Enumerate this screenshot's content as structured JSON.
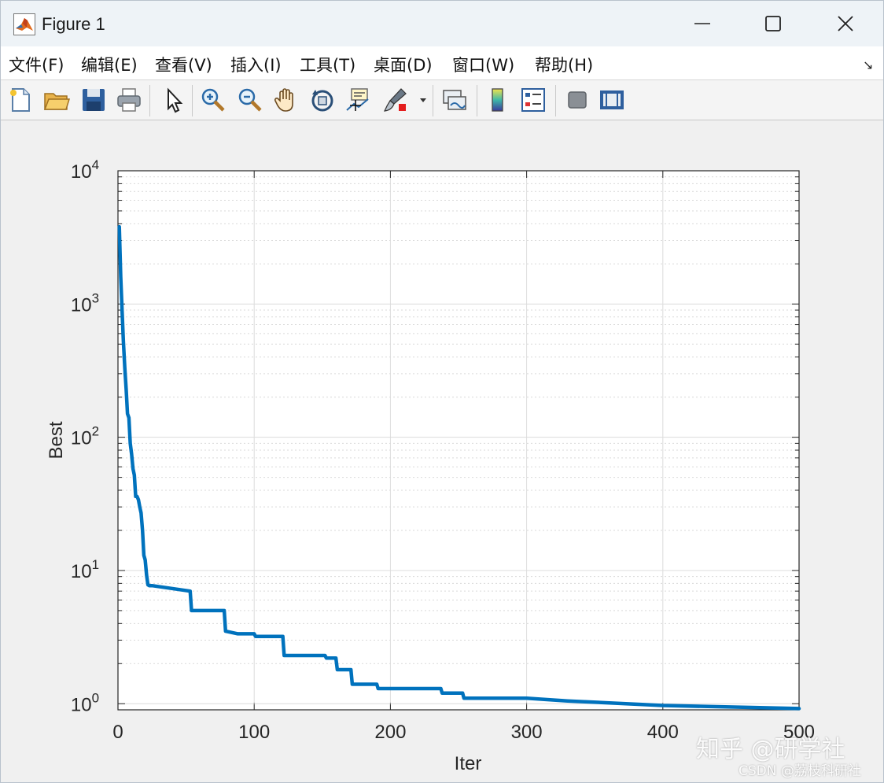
{
  "window": {
    "title": "Figure 1"
  },
  "menu": {
    "items": [
      "文件(F)",
      "编辑(E)",
      "查看(V)",
      "插入(I)",
      "工具(T)",
      "桌面(D)",
      "窗口(W)",
      "帮助(H)"
    ]
  },
  "toolbar": {
    "icons": [
      "new-figure-icon",
      "open-file-icon",
      "save-icon",
      "print-icon",
      "edit-plot-arrow-icon",
      "zoom-in-icon",
      "zoom-out-icon",
      "pan-hand-icon",
      "rotate-3d-icon",
      "data-cursor-icon",
      "brush-icon",
      "brush-dropdown-icon",
      "link-plot-icon",
      "colorbar-icon",
      "legend-icon",
      "hide-plot-tools-icon",
      "show-plot-tools-icon"
    ]
  },
  "watermark": {
    "line1": "知乎 @研学社",
    "line2": "CSDN @荔枝科研社"
  },
  "chart_data": {
    "type": "line",
    "xlabel": "Iter",
    "ylabel": "Best",
    "xlim": [
      0,
      500
    ],
    "ylim": [
      0.9,
      10000
    ],
    "yscale": "log",
    "grid": true,
    "minor_grid": true,
    "x_ticks": [
      0,
      100,
      200,
      300,
      400,
      500
    ],
    "y_ticks": [
      {
        "base": "10",
        "exp": "0"
      },
      {
        "base": "10",
        "exp": "1"
      },
      {
        "base": "10",
        "exp": "2"
      },
      {
        "base": "10",
        "exp": "3"
      },
      {
        "base": "10",
        "exp": "4"
      }
    ],
    "line_color": "#0072bd",
    "series": [
      {
        "x": [
          1,
          2,
          3,
          4,
          5,
          6,
          7,
          8,
          9,
          10,
          11,
          12,
          13,
          14,
          15,
          16,
          17,
          18,
          19,
          20,
          21,
          22,
          23,
          24,
          25,
          53,
          54,
          78,
          79,
          88,
          100,
          101,
          121,
          122,
          152,
          153,
          160,
          161,
          171,
          172,
          190,
          191,
          237,
          238,
          253,
          254,
          300,
          330,
          400,
          500
        ],
        "y": [
          3800,
          1600,
          900,
          520,
          330,
          230,
          150,
          140,
          90,
          75,
          58,
          52,
          36,
          36,
          34,
          30,
          27,
          20,
          13,
          12,
          9.2,
          7.8,
          7.7,
          7.7,
          7.7,
          7.0,
          5.0,
          5.0,
          3.5,
          3.35,
          3.35,
          3.2,
          3.2,
          2.3,
          2.3,
          2.2,
          2.2,
          1.8,
          1.8,
          1.4,
          1.4,
          1.3,
          1.3,
          1.2,
          1.2,
          1.1,
          1.1,
          1.05,
          0.97,
          0.92
        ]
      }
    ]
  }
}
